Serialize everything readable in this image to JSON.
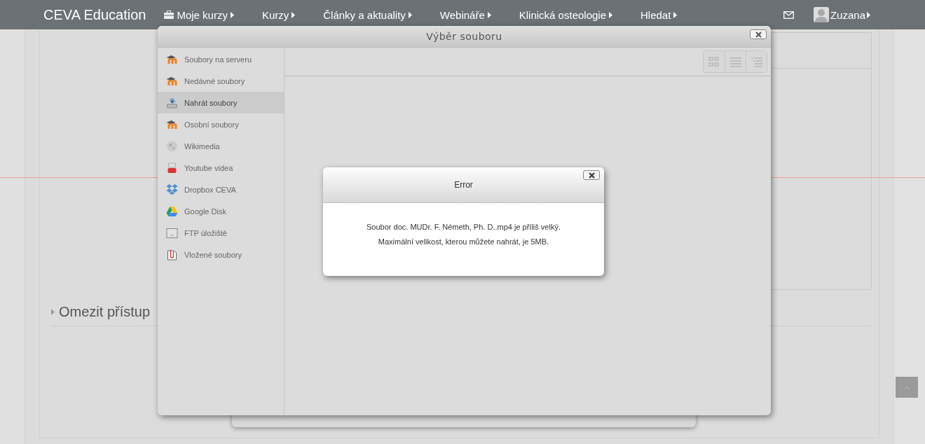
{
  "navbar": {
    "brand": "CEVA Education",
    "menu": [
      {
        "label": "Moje kurzy",
        "kind": "briefcase"
      },
      {
        "label": "Kurzy",
        "kind": "plain"
      },
      {
        "label": "Články a aktuality",
        "kind": "plain"
      },
      {
        "label": "Webináře",
        "kind": "plain"
      },
      {
        "label": "Klinická osteologie",
        "kind": "plain"
      },
      {
        "label": "Hledat",
        "kind": "plain"
      }
    ],
    "user": "Zuzana"
  },
  "page": {
    "section": "Omezit přístup"
  },
  "file_picker": {
    "title": "Výběr souboru",
    "repositories": [
      {
        "label": "Soubory na serveru",
        "kind": "moodle",
        "selected": false
      },
      {
        "label": "Nedávné soubory",
        "kind": "moodle",
        "selected": false
      },
      {
        "label": "Nahrát soubory",
        "kind": "upload",
        "selected": true
      },
      {
        "label": "Osobní soubory",
        "kind": "moodle",
        "selected": false
      },
      {
        "label": "Wikimedia",
        "kind": "globe",
        "selected": false
      },
      {
        "label": "Youtube videa",
        "kind": "youtube",
        "selected": false
      },
      {
        "label": "Dropbox CEVA",
        "kind": "dropbox",
        "selected": false
      },
      {
        "label": "Google Disk",
        "kind": "drive",
        "selected": false
      },
      {
        "label": "FTP úložiště",
        "kind": "ftp",
        "selected": false
      },
      {
        "label": "Vložené soubory",
        "kind": "clip",
        "selected": false
      }
    ],
    "view_buttons": [
      {
        "kind": "icons"
      },
      {
        "kind": "list"
      },
      {
        "kind": "tree"
      }
    ]
  },
  "error_dialog": {
    "title": "Error",
    "lines": [
      "Soubor doc. MUDr. F. Németh, Ph. D..mp4 je příliš velký.",
      "Maximální velikost, kterou můžete nahrát, je 5MB."
    ]
  }
}
